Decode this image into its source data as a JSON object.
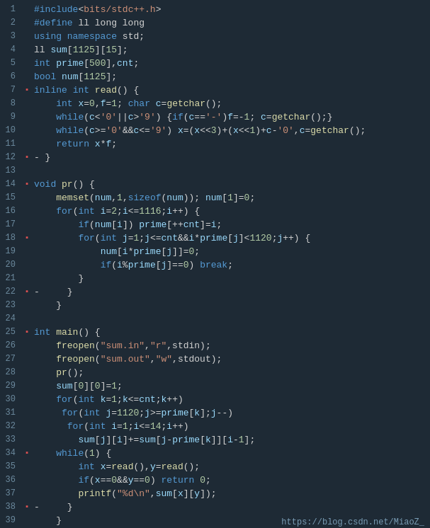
{
  "editor": {
    "background": "#1e2a35",
    "url": "https://blog.csdn.net/MiaoZ_",
    "lines": [
      {
        "num": 1,
        "fold": "",
        "html": "<span class='pp'>#include</span><span class='plain'>&lt;</span><span class='str'>bits/stdc++.h</span><span class='plain'>&gt;</span>"
      },
      {
        "num": 2,
        "fold": "",
        "html": "<span class='pp'>#define</span><span class='plain'> ll long long</span>"
      },
      {
        "num": 3,
        "fold": "",
        "html": "<span class='kw'>using namespace</span><span class='plain'> std;</span>"
      },
      {
        "num": 4,
        "fold": "",
        "html": "<span class='plain'>ll </span><span class='var'>sum</span><span class='plain'>[</span><span class='num'>1125</span><span class='plain'>][</span><span class='num'>15</span><span class='plain'>];</span>"
      },
      {
        "num": 5,
        "fold": "",
        "html": "<span class='kw'>int</span><span class='plain'> </span><span class='var'>prime</span><span class='plain'>[</span><span class='num'>500</span><span class='plain'>],</span><span class='var'>cnt</span><span class='plain'>;</span>"
      },
      {
        "num": 6,
        "fold": "",
        "html": "<span class='kw'>bool</span><span class='plain'> </span><span class='var'>num</span><span class='plain'>[</span><span class='num'>1125</span><span class='plain'>];</span>"
      },
      {
        "num": 7,
        "fold": "▪",
        "html": "<span class='kw'>inline</span><span class='plain'> </span><span class='kw'>int</span><span class='plain'> </span><span class='fn'>read</span><span class='plain'>() {</span>"
      },
      {
        "num": 8,
        "fold": "",
        "html": "<span class='plain'>    </span><span class='kw'>int</span><span class='plain'> </span><span class='var'>x</span><span class='plain'>=</span><span class='num'>0</span><span class='plain'>,</span><span class='var'>f</span><span class='plain'>=</span><span class='num'>1</span><span class='plain'>; </span><span class='kw'>char</span><span class='plain'> </span><span class='var'>c</span><span class='plain'>=</span><span class='fn'>getchar</span><span class='plain'>();</span>"
      },
      {
        "num": 9,
        "fold": "",
        "html": "<span class='plain'>    </span><span class='kw'>while</span><span class='plain'>(</span><span class='var'>c</span><span class='plain'>&lt;</span><span class='str'>'0'</span><span class='plain'>||</span><span class='var'>c</span><span class='plain'>&gt;</span><span class='str'>'9'</span><span class='plain'>) {</span><span class='kw'>if</span><span class='plain'>(</span><span class='var'>c</span><span class='plain'>==</span><span class='str'>'-'</span><span class='plain'>)</span><span class='var'>f</span><span class='plain'>=-</span><span class='num'>1</span><span class='plain'>; </span><span class='var'>c</span><span class='plain'>=</span><span class='fn'>getchar</span><span class='plain'>();}</span>"
      },
      {
        "num": 10,
        "fold": "",
        "html": "<span class='plain'>    </span><span class='kw'>while</span><span class='plain'>(</span><span class='var'>c</span><span class='plain'>&gt;=</span><span class='str'>'0'</span><span class='plain'>&amp;&amp;</span><span class='var'>c</span><span class='plain'>&lt;=</span><span class='str'>'9'</span><span class='plain'>) </span><span class='var'>x</span><span class='plain'>=(</span><span class='var'>x</span><span class='plain'>&lt;&lt;</span><span class='num'>3</span><span class='plain'>)+(</span><span class='var'>x</span><span class='plain'>&lt;&lt;</span><span class='num'>1</span><span class='plain'>)+</span><span class='var'>c</span><span class='plain'>-</span><span class='str'>'0'</span><span class='plain'>,</span><span class='var'>c</span><span class='plain'>=</span><span class='fn'>getchar</span><span class='plain'>();</span>"
      },
      {
        "num": 11,
        "fold": "",
        "html": "<span class='plain'>    </span><span class='kw'>return</span><span class='plain'> </span><span class='var'>x</span><span class='plain'>*</span><span class='var'>f</span><span class='plain'>;</span>"
      },
      {
        "num": 12,
        "fold": "▪",
        "html": "<span class='plain'>- }</span>"
      },
      {
        "num": 13,
        "fold": "",
        "html": ""
      },
      {
        "num": 14,
        "fold": "▪",
        "html": "<span class='kw'>void</span><span class='plain'> </span><span class='fn'>pr</span><span class='plain'>() {</span>"
      },
      {
        "num": 15,
        "fold": "",
        "html": "<span class='plain'>    </span><span class='fn'>memset</span><span class='plain'>(</span><span class='var'>num</span><span class='plain'>,</span><span class='num'>1</span><span class='plain'>,</span><span class='kw'>sizeof</span><span class='plain'>(</span><span class='var'>num</span><span class='plain'>)); </span><span class='var'>num</span><span class='plain'>[</span><span class='num'>1</span><span class='plain'>]=</span><span class='num'>0</span><span class='plain'>;</span>"
      },
      {
        "num": 16,
        "fold": "",
        "html": "<span class='plain'>    </span><span class='kw'>for</span><span class='plain'>(</span><span class='kw'>int</span><span class='plain'> </span><span class='var'>i</span><span class='plain'>=</span><span class='num'>2</span><span class='plain'>;</span><span class='var'>i</span><span class='plain'>&lt;=</span><span class='num'>1116</span><span class='plain'>;</span><span class='var'>i</span><span class='plain'>++) {</span>"
      },
      {
        "num": 17,
        "fold": "",
        "html": "<span class='plain'>        </span><span class='kw'>if</span><span class='plain'>(</span><span class='var'>num</span><span class='plain'>[</span><span class='var'>i</span><span class='plain'>]) </span><span class='var'>prime</span><span class='plain'>[++</span><span class='var'>cnt</span><span class='plain'>]=</span><span class='var'>i</span><span class='plain'>;</span>"
      },
      {
        "num": 18,
        "fold": "▪",
        "html": "<span class='plain'>        </span><span class='kw'>for</span><span class='plain'>(</span><span class='kw'>int</span><span class='plain'> </span><span class='var'>j</span><span class='plain'>=</span><span class='num'>1</span><span class='plain'>;</span><span class='var'>j</span><span class='plain'>&lt;=</span><span class='var'>cnt</span><span class='plain'>&amp;&amp;</span><span class='var'>i</span><span class='plain'>*</span><span class='var'>prime</span><span class='plain'>[</span><span class='var'>j</span><span class='plain'>]&lt;</span><span class='num'>1120</span><span class='plain'>;</span><span class='var'>j</span><span class='plain'>++) {</span>"
      },
      {
        "num": 19,
        "fold": "",
        "html": "<span class='plain'>            </span><span class='var'>num</span><span class='plain'>[</span><span class='var'>i</span><span class='plain'>*</span><span class='var'>prime</span><span class='plain'>[</span><span class='var'>j</span><span class='plain'>]]=</span><span class='num'>0</span><span class='plain'>;</span>"
      },
      {
        "num": 20,
        "fold": "",
        "html": "<span class='plain'>            </span><span class='kw'>if</span><span class='plain'>(</span><span class='var'>i</span><span class='plain'>%</span><span class='var'>prime</span><span class='plain'>[</span><span class='var'>j</span><span class='plain'>]==</span><span class='num'>0</span><span class='plain'>) </span><span class='kw'>break</span><span class='plain'>;</span>"
      },
      {
        "num": 21,
        "fold": "",
        "html": "<span class='plain'>        }</span>"
      },
      {
        "num": 22,
        "fold": "▪",
        "html": "<span class='plain'>-     }</span>"
      },
      {
        "num": 23,
        "fold": "",
        "html": "<span class='plain'>    }</span>"
      },
      {
        "num": 24,
        "fold": "",
        "html": ""
      },
      {
        "num": 25,
        "fold": "▪",
        "html": "<span class='kw'>int</span><span class='plain'> </span><span class='fn'>main</span><span class='plain'>() {</span>"
      },
      {
        "num": 26,
        "fold": "",
        "html": "<span class='plain'>    </span><span class='fn'>freopen</span><span class='plain'>(</span><span class='str'>\"sum.in\"</span><span class='plain'>,</span><span class='str'>\"r\"</span><span class='plain'>,stdin);</span>"
      },
      {
        "num": 27,
        "fold": "",
        "html": "<span class='plain'>    </span><span class='fn'>freopen</span><span class='plain'>(</span><span class='str'>\"sum.out\"</span><span class='plain'>,</span><span class='str'>\"w\"</span><span class='plain'>,stdout);</span>"
      },
      {
        "num": 28,
        "fold": "",
        "html": "<span class='plain'>    </span><span class='fn'>pr</span><span class='plain'>();</span>"
      },
      {
        "num": 29,
        "fold": "",
        "html": "<span class='plain'>    </span><span class='var'>sum</span><span class='plain'>[</span><span class='num'>0</span><span class='plain'>][</span><span class='num'>0</span><span class='plain'>]=</span><span class='num'>1</span><span class='plain'>;</span>"
      },
      {
        "num": 30,
        "fold": "",
        "html": "<span class='plain'>    </span><span class='kw'>for</span><span class='plain'>(</span><span class='kw'>int</span><span class='plain'> </span><span class='var'>k</span><span class='plain'>=</span><span class='num'>1</span><span class='plain'>;</span><span class='var'>k</span><span class='plain'>&lt;=</span><span class='var'>cnt</span><span class='plain'>;</span><span class='var'>k</span><span class='plain'>++)</span>"
      },
      {
        "num": 31,
        "fold": "",
        "html": "<span class='plain'>     </span><span class='kw'>for</span><span class='plain'>(</span><span class='kw'>int</span><span class='plain'> </span><span class='var'>j</span><span class='plain'>=</span><span class='num'>1120</span><span class='plain'>;</span><span class='var'>j</span><span class='plain'>&gt;=</span><span class='var'>prime</span><span class='plain'>[</span><span class='var'>k</span><span class='plain'>];</span><span class='var'>j</span><span class='plain'>--)</span>"
      },
      {
        "num": 32,
        "fold": "",
        "html": "<span class='plain'>      </span><span class='kw'>for</span><span class='plain'>(</span><span class='kw'>int</span><span class='plain'> </span><span class='var'>i</span><span class='plain'>=</span><span class='num'>1</span><span class='plain'>;</span><span class='var'>i</span><span class='plain'>&lt;=</span><span class='num'>14</span><span class='plain'>;</span><span class='var'>i</span><span class='plain'>++)</span>"
      },
      {
        "num": 33,
        "fold": "",
        "html": "<span class='plain'>        </span><span class='var'>sum</span><span class='plain'>[</span><span class='var'>j</span><span class='plain'>][</span><span class='var'>i</span><span class='plain'>]+=</span><span class='var'>sum</span><span class='plain'>[</span><span class='var'>j</span><span class='plain'>-</span><span class='var'>prime</span><span class='plain'>[</span><span class='var'>k</span><span class='plain'>]][</span><span class='var'>i</span><span class='plain'>-</span><span class='num'>1</span><span class='plain'>];</span>"
      },
      {
        "num": 34,
        "fold": "▪",
        "html": "<span class='plain'>    </span><span class='kw'>while</span><span class='plain'>(</span><span class='num'>1</span><span class='plain'>) {</span>"
      },
      {
        "num": 35,
        "fold": "",
        "html": "<span class='plain'>        </span><span class='kw'>int</span><span class='plain'> </span><span class='var'>x</span><span class='plain'>=</span><span class='fn'>read</span><span class='plain'>(),</span><span class='var'>y</span><span class='plain'>=</span><span class='fn'>read</span><span class='plain'>();</span>"
      },
      {
        "num": 36,
        "fold": "",
        "html": "<span class='plain'>        </span><span class='kw'>if</span><span class='plain'>(</span><span class='var'>x</span><span class='plain'>==</span><span class='num'>0</span><span class='plain'>&amp;&amp;</span><span class='var'>y</span><span class='plain'>==</span><span class='num'>0</span><span class='plain'>) </span><span class='kw'>return</span><span class='plain'> </span><span class='num'>0</span><span class='plain'>;</span>"
      },
      {
        "num": 37,
        "fold": "",
        "html": "<span class='plain'>        </span><span class='fn'>printf</span><span class='plain'>(</span><span class='str'>\"%d\\n\"</span><span class='plain'>,</span><span class='var'>sum</span><span class='plain'>[</span><span class='var'>x</span><span class='plain'>][</span><span class='var'>y</span><span class='plain'>]);</span>"
      },
      {
        "num": 38,
        "fold": "▪",
        "html": "<span class='plain'>-     }</span>"
      },
      {
        "num": 39,
        "fold": "",
        "html": "<span class='plain'>    }</span>"
      }
    ]
  }
}
